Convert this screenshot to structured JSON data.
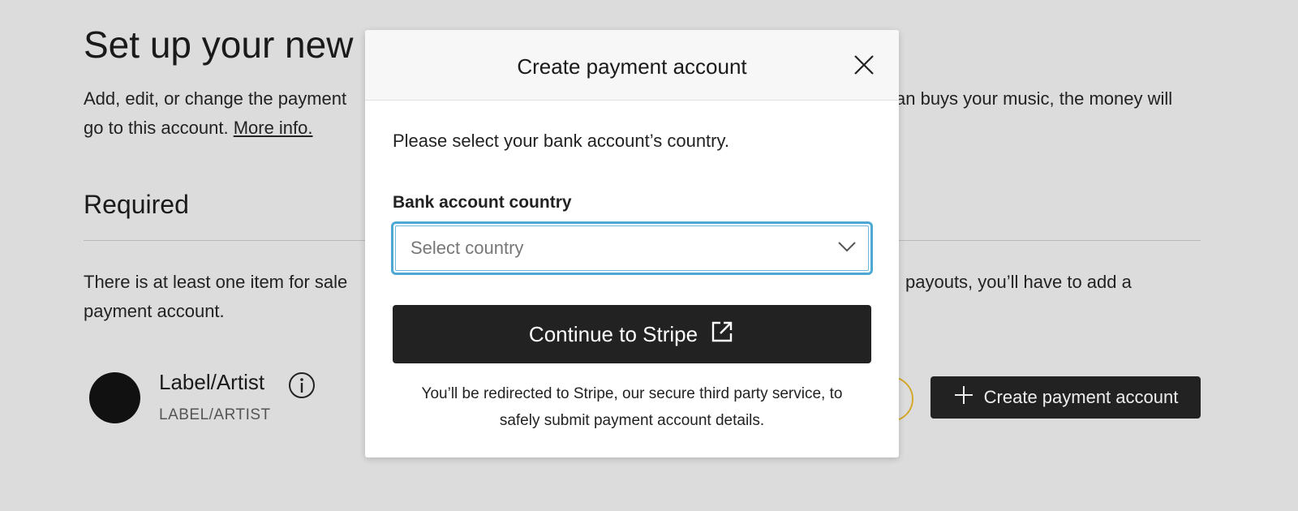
{
  "background": {
    "title": "Set up your new",
    "para1_left_line1": "Add, edit, or change the payment",
    "para1_right_line1": "an buys your music, the money will",
    "para1_line2_prefix": "go to this account.",
    "para1_link": "More info.",
    "section_heading": "Required",
    "para2_left_line1": "There is at least one item for sale",
    "para2_right_line1": "payouts, you’ll have to add a",
    "para2_line2": "payment account.",
    "entity_name": "Label/Artist",
    "entity_type": "LABEL/ARTIST",
    "create_button_label": "Create payment account"
  },
  "modal": {
    "title": "Create payment account",
    "instruction": "Please select your bank account’s country.",
    "field_label": "Bank account country",
    "select_placeholder": "Select country",
    "continue_label": "Continue to Stripe",
    "note_line1": "You’ll be redirected to Stripe, our secure third party service, to",
    "note_line2": "safely submit payment account details."
  },
  "icons": {
    "close": "close-icon",
    "chevron": "chevron-down-icon",
    "external": "external-link-icon",
    "info": "info-icon",
    "plus": "plus-icon"
  },
  "colors": {
    "overlay_bg": "#dcdcdc",
    "button_dark": "#222222",
    "focus_ring": "#4ea8d4",
    "badge_ring": "#d4a82a"
  }
}
